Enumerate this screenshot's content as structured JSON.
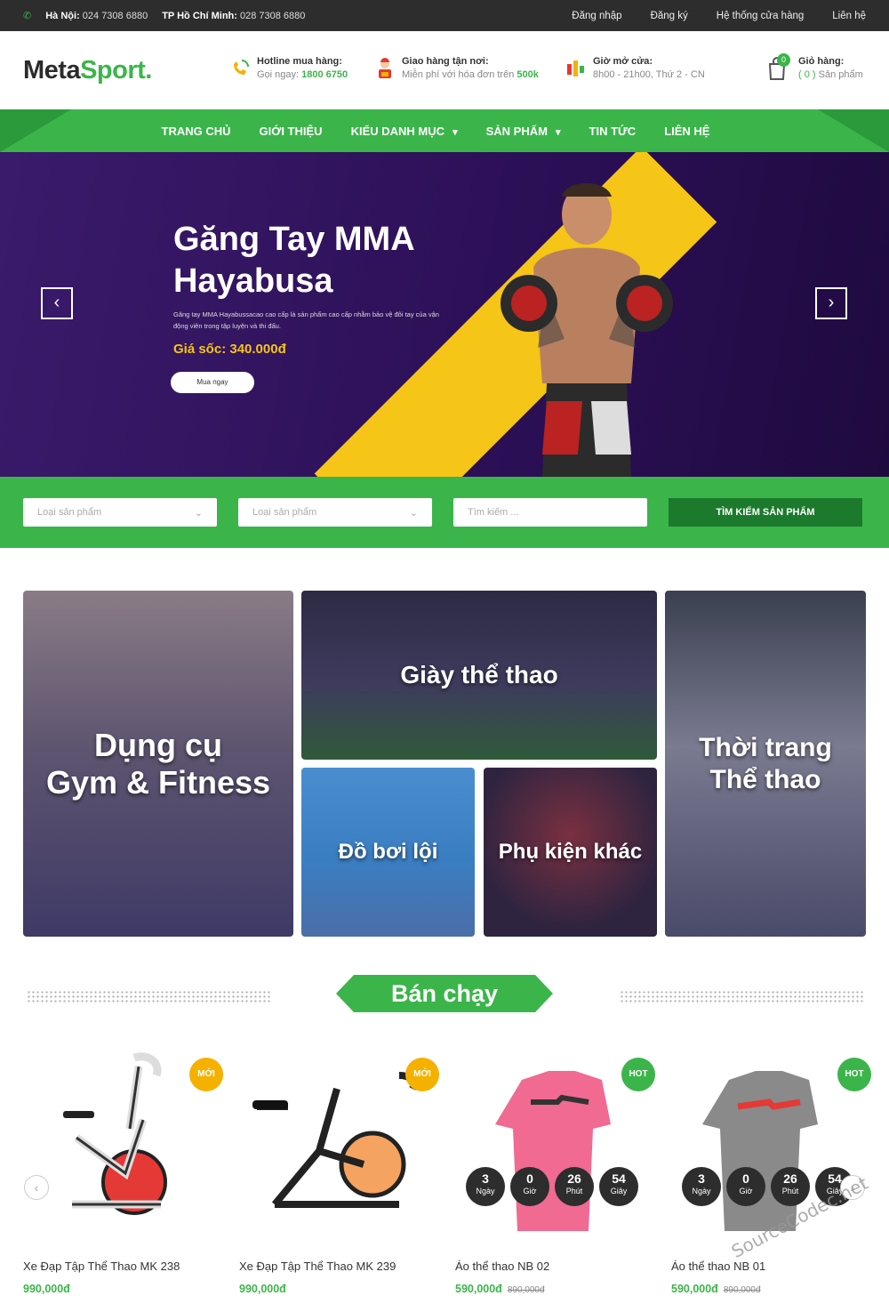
{
  "topbar": {
    "hanoi_label": "Hà Nội:",
    "hanoi_phone": "024 7308 6880",
    "hcm_label": "TP Hồ Chí Minh:",
    "hcm_phone": "028 7308 6880",
    "links": [
      "Đăng nhập",
      "Đăng ký",
      "Hệ thống cửa hàng",
      "Liên hệ"
    ]
  },
  "header": {
    "logo_a": "Meta",
    "logo_b": "Sport.",
    "hotline_title": "Hotline mua hàng:",
    "hotline_text": "Gọi ngay:",
    "hotline_phone": "1800 6750",
    "delivery_title": "Giao hàng tận nơi:",
    "delivery_text": "Miễn phí với hóa đơn trên",
    "delivery_value": "500k",
    "hours_title": "Giờ mở cửa:",
    "hours_text": "8h00 - 21h00, Thứ 2 - CN",
    "cart_title": "Giỏ hàng:",
    "cart_count": "( 0 )",
    "cart_unit": "Sản phẩm",
    "cart_badge": "0"
  },
  "nav": {
    "items": [
      "TRANG CHỦ",
      "GIỚI THIỆU",
      "KIỂU DANH MỤC",
      "SẢN PHẨM",
      "TIN TỨC",
      "LIÊN HỆ"
    ]
  },
  "hero": {
    "title": "Găng Tay MMA Hayabusa",
    "description": "Găng tay MMA Hayabussacao cao cấp là sản phẩm cao cấp nhằm bảo vệ đôi tay của vận động viên trong tập luyện và thi đấu.",
    "price": "Giá sốc: 340.000đ",
    "button": "Mua ngay",
    "prev": "‹",
    "next": "›"
  },
  "search": {
    "select1": "Loại sản phẩm",
    "select2": "Loại sản phẩm",
    "input_placeholder": "Tìm kiếm ...",
    "button": "TÌM KIẾM SẢN PHẨM"
  },
  "categories": {
    "gym_line1": "Dụng cụ",
    "gym_line2": "Gym & Fitness",
    "shoes": "Giày thể thao",
    "swim": "Đồ bơi lội",
    "accessories": "Phụ kiện khác",
    "fashion_line1": "Thời trang",
    "fashion_line2": "Thể thao"
  },
  "bestseller": {
    "title": "Bán chạy",
    "products": [
      {
        "name": "Xe Đạp Tập Thể Thao MK 238",
        "price": "990,000đ",
        "old_price": "",
        "tag": "MỚI"
      },
      {
        "name": "Xe Đạp Tập Thể Thao MK 239",
        "price": "990,000đ",
        "old_price": "",
        "tag": "MỚI"
      },
      {
        "name": "Áo thể thao NB 02",
        "price": "590,000đ",
        "old_price": "890,000đ",
        "tag": "HOT"
      },
      {
        "name": "Áo thể thao NB 01",
        "price": "590,000đ",
        "old_price": "890,000đ",
        "tag": "HOT"
      }
    ],
    "countdown": [
      {
        "value": "3",
        "unit": "Ngày"
      },
      {
        "value": "0",
        "unit": "Giờ"
      },
      {
        "value": "26",
        "unit": "Phút"
      },
      {
        "value": "54",
        "unit": "Giây"
      }
    ],
    "stars": "★★★★★"
  },
  "colors": {
    "brand_green": "#3bb54a",
    "dark_green": "#1c7a2c",
    "tag_yellow": "#f5b100",
    "tag_green": "#3bb54a",
    "hero_purple": "#2b0f55",
    "hero_yellow": "#f5c518"
  },
  "watermark": "SourceCodec.net"
}
